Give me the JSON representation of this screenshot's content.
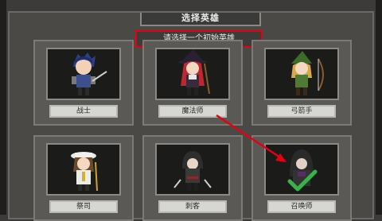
{
  "title": "选择英雄",
  "subtitle": "请选择一个初始英雄",
  "heroes": [
    {
      "name": "战士"
    },
    {
      "name": "魔法师"
    },
    {
      "name": "弓箭手"
    },
    {
      "name": "祭司"
    },
    {
      "name": "刺客"
    },
    {
      "name": "召唤师"
    }
  ],
  "colors": {
    "highlight": "#e60012",
    "check": "#37b34a"
  }
}
